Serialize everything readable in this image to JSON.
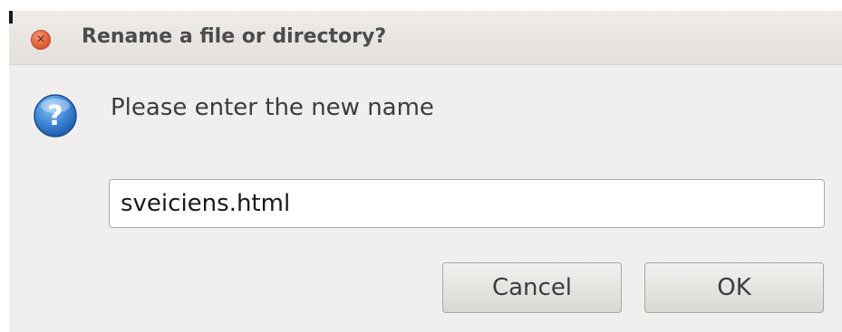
{
  "dialog": {
    "title": "Rename a file or directory?",
    "close_symbol": "×",
    "icon": "question-icon",
    "prompt": "Please enter the new name",
    "input_value": "sveiciens.html",
    "cancel_label": "Cancel",
    "ok_label": "OK"
  },
  "colors": {
    "background": "#f0efee",
    "close_button": "#e0592f",
    "question_icon": "#2f78c8"
  }
}
